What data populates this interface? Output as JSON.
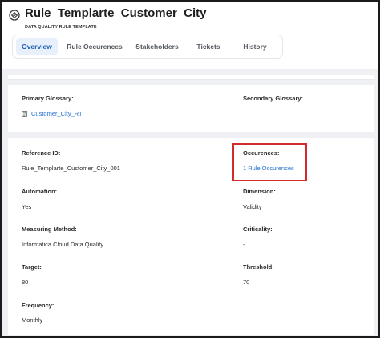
{
  "header": {
    "title": "Rule_Templarte_Customer_City",
    "subtitle": "DATA QUALITY RULE TEMPLATE",
    "icon": "rule-template-icon"
  },
  "tabs": [
    {
      "label": "Overview",
      "active": true
    },
    {
      "label": "Rule Occurences",
      "active": false
    },
    {
      "label": "Stakeholders",
      "active": false
    },
    {
      "label": "Tickets",
      "active": false
    },
    {
      "label": "History",
      "active": false
    }
  ],
  "glossary": {
    "primary_label": "Primary Glossary:",
    "primary_value": "Customer_City_RT",
    "secondary_label": "Secondary Glossary:"
  },
  "details": {
    "reference_id_label": "Reference ID:",
    "reference_id_value": "Rule_Templarte_Customer_City_001",
    "occurences_label": "Occurences:",
    "occurences_value": "1 Rule Occurences",
    "automation_label": "Automation:",
    "automation_value": "Yes",
    "dimension_label": "Dimension:",
    "dimension_value": "Validity",
    "measuring_method_label": "Measuring Method:",
    "measuring_method_value": "Informatica Cloud Data Quality",
    "criticality_label": "Criticality:",
    "criticality_value": "-",
    "target_label": "Target:",
    "target_value": "80",
    "threshold_label": "Threshold:",
    "threshold_value": "70",
    "frequency_label": "Frequency:",
    "frequency_value": "Monthly"
  },
  "colors": {
    "link": "#1f6fd1",
    "highlight_box": "#d42a2a",
    "active_tab_bg": "#e8f0fb"
  }
}
